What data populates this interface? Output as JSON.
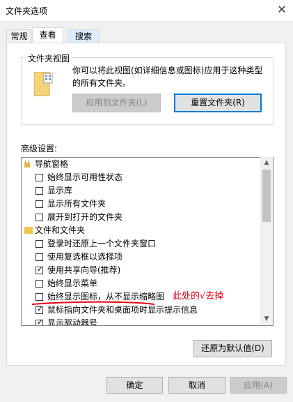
{
  "window": {
    "title": "文件夹选项",
    "close_icon": "close-icon"
  },
  "tabs": [
    {
      "label": "常规"
    },
    {
      "label": "查看"
    },
    {
      "label": "搜索"
    }
  ],
  "folder_view": {
    "group_label": "文件夹视图",
    "description": "你可以将此视图(如详细信息或图标)应用于这种类型的所有文件夹。",
    "apply_button": "应用到文件夹(L)",
    "reset_button": "重置文件夹(R)"
  },
  "advanced": {
    "label": "高级设置:",
    "items": [
      {
        "type": "folder",
        "label": "导航窗格"
      },
      {
        "type": "checkbox",
        "checked": false,
        "label": "始终显示可用性状态"
      },
      {
        "type": "checkbox",
        "checked": false,
        "label": "显示库"
      },
      {
        "type": "checkbox",
        "checked": false,
        "label": "显示所有文件夹"
      },
      {
        "type": "checkbox",
        "checked": false,
        "label": "展开到打开的文件夹"
      },
      {
        "type": "folder",
        "label": "文件和文件夹"
      },
      {
        "type": "checkbox",
        "checked": false,
        "label": "登录时还原上一个文件夹窗口"
      },
      {
        "type": "checkbox",
        "checked": false,
        "label": "使用复选框以选择项"
      },
      {
        "type": "checkbox",
        "checked": true,
        "label": "使用共享向导(推荐)"
      },
      {
        "type": "checkbox",
        "checked": false,
        "label": "始终显示菜单"
      },
      {
        "type": "checkbox",
        "checked": false,
        "label": "始终显示图标，从不显示缩略图"
      },
      {
        "type": "checkbox",
        "checked": true,
        "label": "鼠标指向文件夹和桌面项时显示提示信息"
      },
      {
        "type": "checkbox",
        "checked": true,
        "label": "显示驱动器号"
      }
    ]
  },
  "annotation": {
    "text": "此处的√去掉",
    "color": "#e60012"
  },
  "restore_defaults_button": "还原为默认值(D)",
  "buttons": {
    "ok": "确定",
    "cancel": "取消",
    "apply": "应用(A)"
  }
}
